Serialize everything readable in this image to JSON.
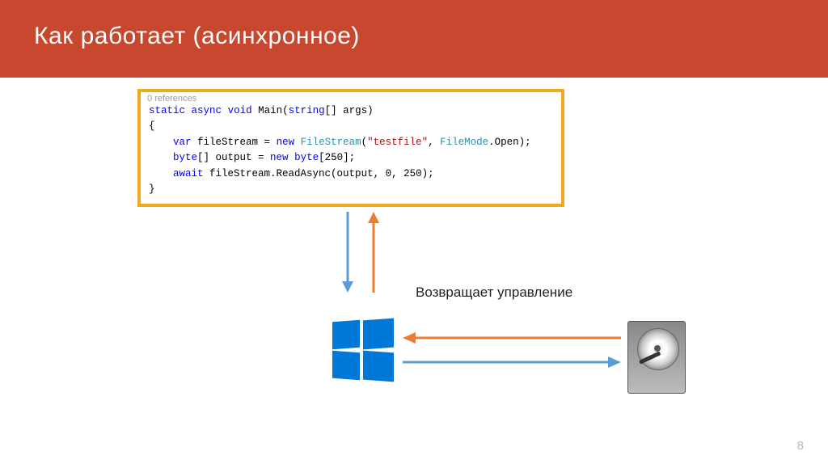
{
  "title": "Как работает (асинхронное)",
  "code": {
    "references": "0 references",
    "kw_static": "static",
    "kw_async": "async",
    "kw_void": "void",
    "method": "Main",
    "kw_string": "string",
    "args": "[] args)",
    "brace_open": "{",
    "kw_var": "var",
    "var1": " fileStream = ",
    "kw_new1": "new",
    "cls_fs": " FileStream",
    "str1": "\"testfile\"",
    "cls_fm": "FileMode",
    "enum_open": ".Open);",
    "kw_byte": "byte",
    "arr_decl": "[] output = ",
    "kw_new2": "new",
    "kw_byte2": " byte",
    "arr_sz": "[250];",
    "kw_await": "await",
    "call": " fileStream.ReadAsync(output, 0, 250);",
    "brace_close": "}"
  },
  "label": "Возвращает управление",
  "page_number": "8",
  "colors": {
    "header": "#c8472f",
    "border": "#f0a81e",
    "blue": "#5b9bd5",
    "orange": "#ed7d31",
    "win": "#0078d7"
  }
}
